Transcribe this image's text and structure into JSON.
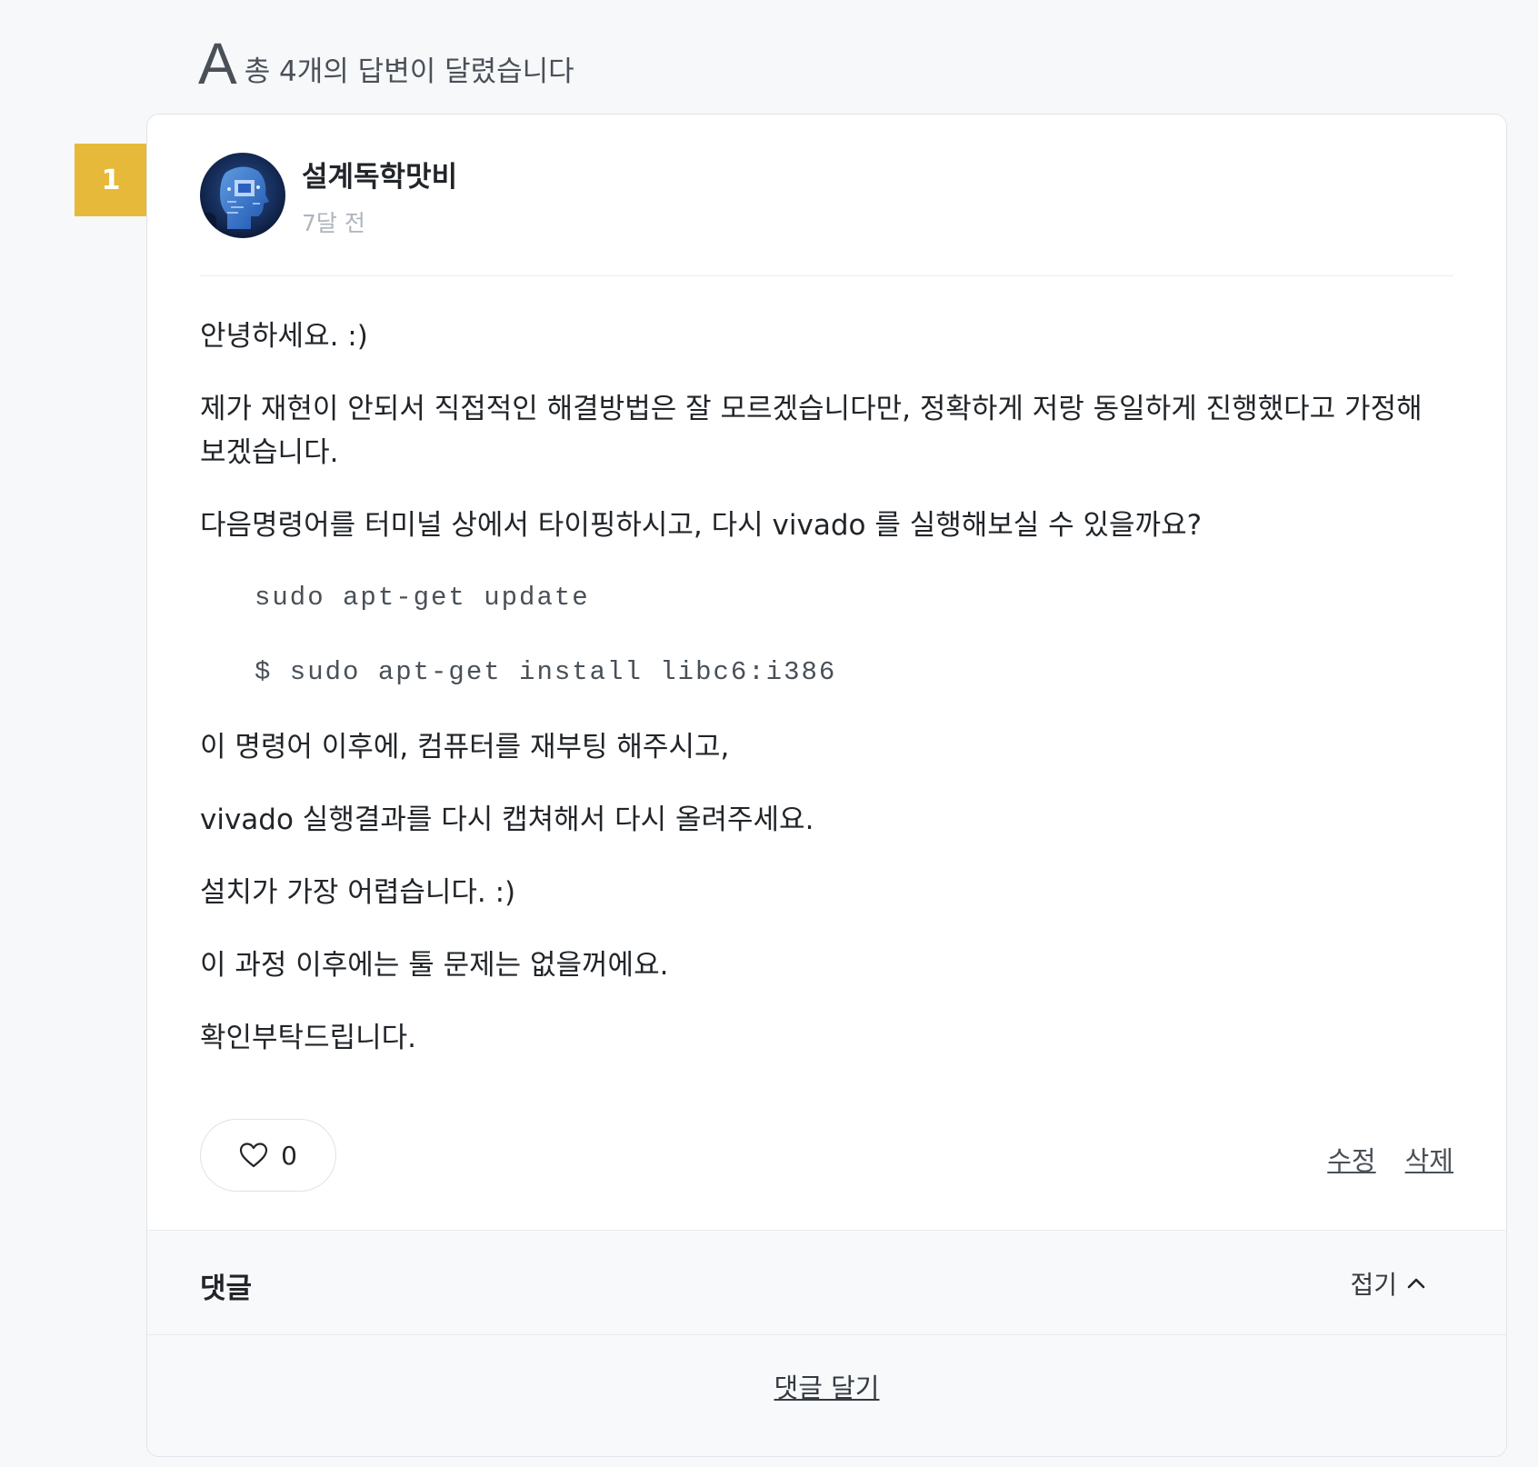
{
  "answers": {
    "letter": "A",
    "count_text": "총 4개의 답변이 달렸습니다"
  },
  "answer": {
    "rank": "1",
    "author_name": "설계독학맛비",
    "time_ago": "7달 전",
    "avatar_icon": "robot-head-avatar",
    "paragraphs": {
      "p1": "안녕하세요. :)",
      "p2": "제가 재현이 안되서 직접적인 해결방법은 잘 모르겠습니다만, 정확하게 저랑 동일하게 진행했다고 가정해 보겠습니다.",
      "p3": "다음명령어를 터미널 상에서 타이핑하시고, 다시 vivado 를 실행해보실 수 있을까요?",
      "code1": "sudo apt-get update",
      "code2": "$ sudo apt-get install libc6:i386",
      "p4": "이 명령어 이후에, 컴퓨터를 재부팅 해주시고,",
      "p5": "vivado 실행결과를 다시 캡쳐해서 다시 올려주세요.",
      "p6": "설치가 가장 어렵습니다. :)",
      "p7": "이 과정 이후에는 툴 문제는 없을꺼에요.",
      "p8": "확인부탁드립니다."
    },
    "like_count": "0",
    "like_icon": "heart-outline-icon",
    "edit_label": "수정",
    "delete_label": "삭제"
  },
  "comments": {
    "title": "댓글",
    "collapse_label": "접기",
    "collapse_icon": "chevron-up-icon",
    "write_label": "댓글 달기"
  },
  "colors": {
    "badge": "#e6b93a",
    "background": "#f7f8fa",
    "card": "#ffffff"
  }
}
